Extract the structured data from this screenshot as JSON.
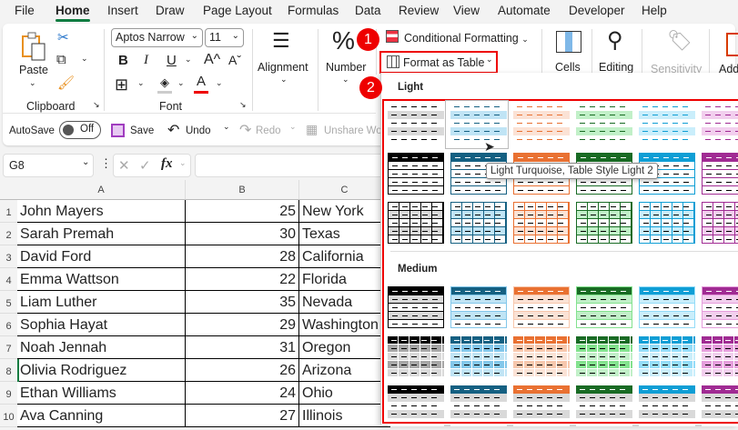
{
  "menu_tabs": [
    "File",
    "Home",
    "Insert",
    "Draw",
    "Page Layout",
    "Formulas",
    "Data",
    "Review",
    "View",
    "Automate",
    "Developer",
    "Help"
  ],
  "active_tab": "Home",
  "ribbon": {
    "clipboard": {
      "paste": "Paste",
      "group": "Clipboard"
    },
    "font": {
      "name": "Aptos Narrow",
      "size": "11",
      "bold": "B",
      "italic": "I",
      "underline": "U",
      "grow": "A^",
      "shrink": "Aˇ",
      "font_color": "A",
      "group": "Font"
    },
    "alignment": "Alignment",
    "number": "Number",
    "conditional_formatting": "Conditional Formatting",
    "format_as_table": "Format as Table",
    "cells": "Cells",
    "editing": "Editing",
    "sensitivity": "Sensitivity",
    "addins": "Add"
  },
  "qat": {
    "autosave": "AutoSave",
    "toggle": "Off",
    "save": "Save",
    "undo": "Undo",
    "redo": "Redo",
    "unshare": "Unshare Wo"
  },
  "formula_bar": {
    "name_box": "G8",
    "fx": "fx",
    "value": ""
  },
  "columns": [
    "A",
    "B",
    "C"
  ],
  "rows": [
    {
      "n": "1",
      "name": "John Mayers",
      "age": "25",
      "state": "New York"
    },
    {
      "n": "2",
      "name": "Sarah Premah",
      "age": "30",
      "state": "Texas"
    },
    {
      "n": "3",
      "name": "David Ford",
      "age": "28",
      "state": "California"
    },
    {
      "n": "4",
      "name": "Emma Wattson",
      "age": "22",
      "state": "Florida"
    },
    {
      "n": "5",
      "name": "Liam Luther",
      "age": "35",
      "state": "Nevada"
    },
    {
      "n": "6",
      "name": "Sophia Hayat",
      "age": "29",
      "state": "Washington"
    },
    {
      "n": "7",
      "name": "Noah Jennah",
      "age": "31",
      "state": "Oregon"
    },
    {
      "n": "8",
      "name": "Olivia Rodriguez",
      "age": "26",
      "state": "Arizona"
    },
    {
      "n": "9",
      "name": "Ethan Williams",
      "age": "24",
      "state": "Ohio"
    },
    {
      "n": "10",
      "name": "Ava Canning",
      "age": "27",
      "state": "Illinois"
    }
  ],
  "selected_cell": "G8",
  "gallery": {
    "sections": [
      "Light",
      "Medium"
    ],
    "palette": [
      {
        "dark": "#000000",
        "light": "#d9d9d9",
        "mid": "#a6a6a6"
      },
      {
        "dark": "#156082",
        "light": "#c0e4f5",
        "mid": "#83c7ea"
      },
      {
        "dark": "#e97132",
        "light": "#fbe2d5",
        "mid": "#f7c7ac"
      },
      {
        "dark": "#196b24",
        "light": "#c1f0c8",
        "mid": "#83e28e"
      },
      {
        "dark": "#0f9ed5",
        "light": "#caeefb",
        "mid": "#94dcf8"
      },
      {
        "dark": "#a02b93",
        "light": "#f2cfee",
        "mid": "#e59edc"
      }
    ],
    "hovered": "Light Turquoise, Table Style Light 2",
    "tooltip": "Light Turquoise, Table Style Light 2"
  },
  "annotations": {
    "step1": "1",
    "step2": "2",
    "highlight_color": "#ff0000"
  }
}
